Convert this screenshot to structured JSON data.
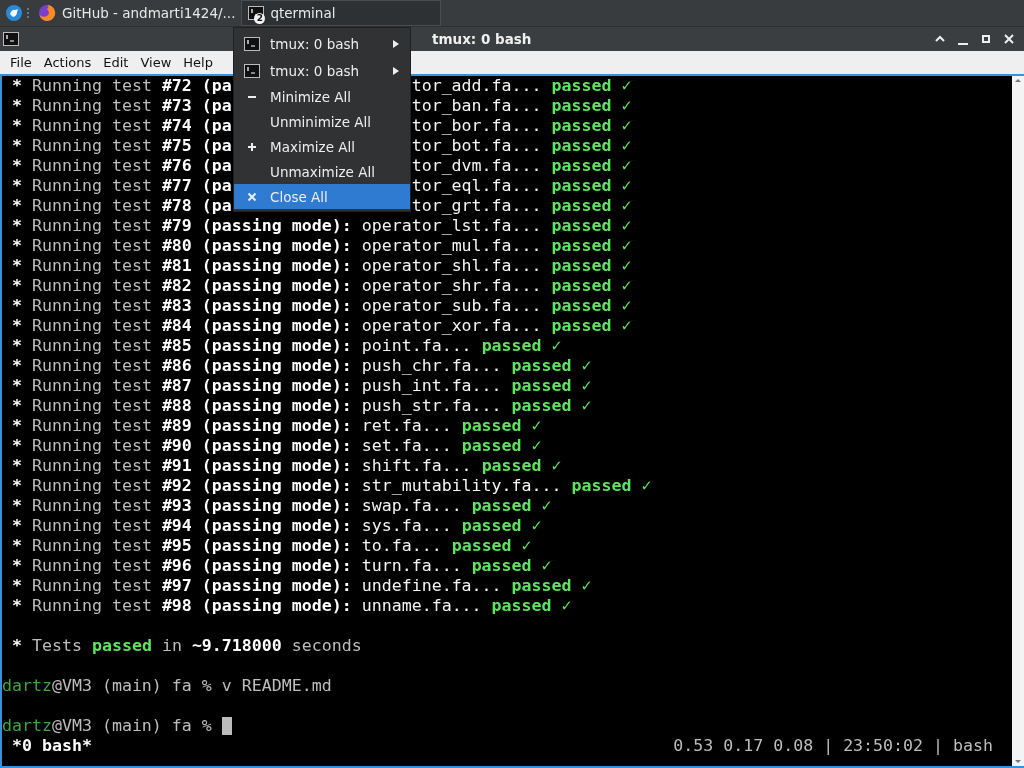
{
  "taskbar": {
    "tasks": [
      {
        "kind": "browser",
        "title": "GitHub - andmarti1424/...",
        "selected": false
      },
      {
        "kind": "terminal",
        "title": "qterminal",
        "badge": "2",
        "selected": true
      }
    ]
  },
  "window": {
    "title": "tmux: 0 bash"
  },
  "menubar": [
    "File",
    "Actions",
    "Edit",
    "View",
    "Help"
  ],
  "popup_menu": {
    "items": [
      {
        "kind": "window",
        "label": "tmux: 0 bash",
        "selected": false
      },
      {
        "kind": "window",
        "label": "tmux: 0 bash",
        "selected": false
      },
      {
        "kind": "minimize",
        "label": "Minimize All",
        "selected": false
      },
      {
        "kind": "plain",
        "label": "Unminimize All",
        "selected": false
      },
      {
        "kind": "maximize",
        "label": "Maximize All",
        "selected": false
      },
      {
        "kind": "plain",
        "label": "Unmaximize All",
        "selected": false
      },
      {
        "kind": "close",
        "label": "Close All",
        "selected": true
      }
    ]
  },
  "terminal": {
    "lines": [
      {
        "kind": "covered",
        "bullet": "*",
        "label": "Running test",
        "number": "#72",
        "mode": "(pa",
        "file": "tor_add.fa...",
        "status": "passed",
        "check": "✓"
      },
      {
        "kind": "covered",
        "bullet": "*",
        "label": "Running test",
        "number": "#73",
        "mode": "(pa",
        "file": "tor_ban.fa...",
        "status": "passed",
        "check": "✓"
      },
      {
        "kind": "covered",
        "bullet": "*",
        "label": "Running test",
        "number": "#74",
        "mode": "(pa",
        "file": "tor_bor.fa...",
        "status": "passed",
        "check": "✓"
      },
      {
        "kind": "covered",
        "bullet": "*",
        "label": "Running test",
        "number": "#75",
        "mode": "(pa",
        "file": "tor_bot.fa...",
        "status": "passed",
        "check": "✓"
      },
      {
        "kind": "covered",
        "bullet": "*",
        "label": "Running test",
        "number": "#76",
        "mode": "(pa",
        "file": "tor_dvm.fa...",
        "status": "passed",
        "check": "✓"
      },
      {
        "kind": "covered",
        "bullet": "*",
        "label": "Running test",
        "number": "#77",
        "mode": "(pa",
        "file": "tor_eql.fa...",
        "status": "passed",
        "check": "✓"
      },
      {
        "kind": "covered",
        "bullet": "*",
        "label": "Running test",
        "number": "#78",
        "mode": "(pa",
        "file": "tor_grt.fa...",
        "status": "passed",
        "check": "✓"
      },
      {
        "kind": "test",
        "bullet": "*",
        "label": "Running test",
        "number": "#79",
        "mode": "(passing mode):",
        "file": "operator_lst.fa...",
        "status": "passed",
        "check": "✓"
      },
      {
        "kind": "test",
        "bullet": "*",
        "label": "Running test",
        "number": "#80",
        "mode": "(passing mode):",
        "file": "operator_mul.fa...",
        "status": "passed",
        "check": "✓"
      },
      {
        "kind": "test",
        "bullet": "*",
        "label": "Running test",
        "number": "#81",
        "mode": "(passing mode):",
        "file": "operator_shl.fa...",
        "status": "passed",
        "check": "✓"
      },
      {
        "kind": "test",
        "bullet": "*",
        "label": "Running test",
        "number": "#82",
        "mode": "(passing mode):",
        "file": "operator_shr.fa...",
        "status": "passed",
        "check": "✓"
      },
      {
        "kind": "test",
        "bullet": "*",
        "label": "Running test",
        "number": "#83",
        "mode": "(passing mode):",
        "file": "operator_sub.fa...",
        "status": "passed",
        "check": "✓"
      },
      {
        "kind": "test",
        "bullet": "*",
        "label": "Running test",
        "number": "#84",
        "mode": "(passing mode):",
        "file": "operator_xor.fa...",
        "status": "passed",
        "check": "✓"
      },
      {
        "kind": "test",
        "bullet": "*",
        "label": "Running test",
        "number": "#85",
        "mode": "(passing mode):",
        "file": "point.fa...",
        "status": "passed",
        "check": "✓"
      },
      {
        "kind": "test",
        "bullet": "*",
        "label": "Running test",
        "number": "#86",
        "mode": "(passing mode):",
        "file": "push_chr.fa...",
        "status": "passed",
        "check": "✓"
      },
      {
        "kind": "test",
        "bullet": "*",
        "label": "Running test",
        "number": "#87",
        "mode": "(passing mode):",
        "file": "push_int.fa...",
        "status": "passed",
        "check": "✓"
      },
      {
        "kind": "test",
        "bullet": "*",
        "label": "Running test",
        "number": "#88",
        "mode": "(passing mode):",
        "file": "push_str.fa...",
        "status": "passed",
        "check": "✓"
      },
      {
        "kind": "test",
        "bullet": "*",
        "label": "Running test",
        "number": "#89",
        "mode": "(passing mode):",
        "file": "ret.fa...",
        "status": "passed",
        "check": "✓"
      },
      {
        "kind": "test",
        "bullet": "*",
        "label": "Running test",
        "number": "#90",
        "mode": "(passing mode):",
        "file": "set.fa...",
        "status": "passed",
        "check": "✓"
      },
      {
        "kind": "test",
        "bullet": "*",
        "label": "Running test",
        "number": "#91",
        "mode": "(passing mode):",
        "file": "shift.fa...",
        "status": "passed",
        "check": "✓"
      },
      {
        "kind": "test",
        "bullet": "*",
        "label": "Running test",
        "number": "#92",
        "mode": "(passing mode):",
        "file": "str_mutability.fa...",
        "status": "passed",
        "check": "✓"
      },
      {
        "kind": "test",
        "bullet": "*",
        "label": "Running test",
        "number": "#93",
        "mode": "(passing mode):",
        "file": "swap.fa...",
        "status": "passed",
        "check": "✓"
      },
      {
        "kind": "test",
        "bullet": "*",
        "label": "Running test",
        "number": "#94",
        "mode": "(passing mode):",
        "file": "sys.fa...",
        "status": "passed",
        "check": "✓"
      },
      {
        "kind": "test",
        "bullet": "*",
        "label": "Running test",
        "number": "#95",
        "mode": "(passing mode):",
        "file": "to.fa...",
        "status": "passed",
        "check": "✓"
      },
      {
        "kind": "test",
        "bullet": "*",
        "label": "Running test",
        "number": "#96",
        "mode": "(passing mode):",
        "file": "turn.fa...",
        "status": "passed",
        "check": "✓"
      },
      {
        "kind": "test",
        "bullet": "*",
        "label": "Running test",
        "number": "#97",
        "mode": "(passing mode):",
        "file": "undefine.fa...",
        "status": "passed",
        "check": "✓"
      },
      {
        "kind": "test",
        "bullet": "*",
        "label": "Running test",
        "number": "#98",
        "mode": "(passing mode):",
        "file": "unname.fa...",
        "status": "passed",
        "check": "✓"
      },
      {
        "kind": "blank"
      },
      {
        "kind": "summary",
        "bullet": "*",
        "label": "Tests",
        "status": "passed",
        "preposition": "in",
        "duration": "~9.718000",
        "unit": "seconds"
      },
      {
        "kind": "blank"
      },
      {
        "kind": "prompt",
        "user": "dartz",
        "host": "@VM3 (main) fa %",
        "command": "v README.md",
        "cursor": false
      },
      {
        "kind": "blank"
      },
      {
        "kind": "prompt",
        "user": "dartz",
        "host": "@VM3 (main) fa %",
        "cursor": true
      }
    ]
  },
  "status_bar": {
    "session": "*0 bash*",
    "info": "0.53 0.17 0.08 | 23:50:02 | bash"
  }
}
